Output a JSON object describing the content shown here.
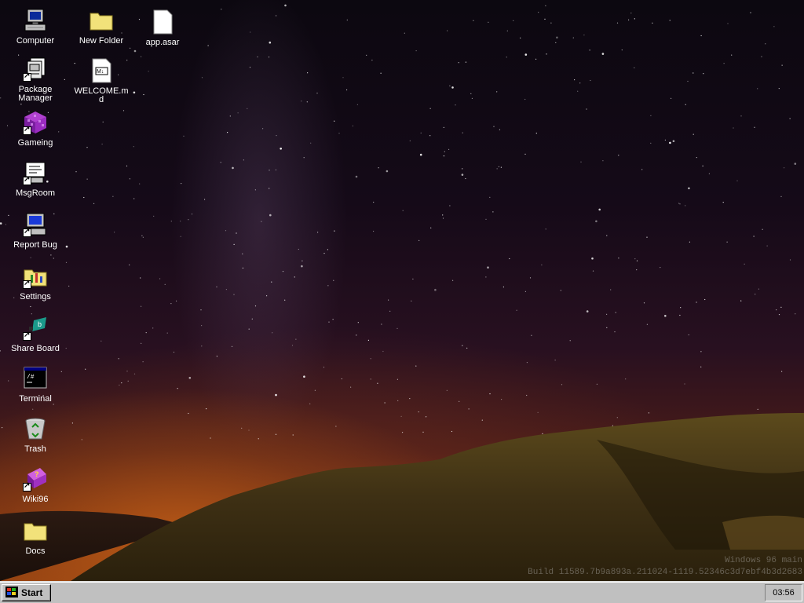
{
  "desktop": {
    "icons": [
      {
        "label": "Computer",
        "icon": "computer-icon"
      },
      {
        "label": "Package Manager",
        "icon": "package-manager-icon"
      },
      {
        "label": "Gameing",
        "icon": "gaming-cube-icon"
      },
      {
        "label": "MsgRoom",
        "icon": "msgroom-icon"
      },
      {
        "label": "Report Bug",
        "icon": "report-bug-icon"
      },
      {
        "label": "Settings",
        "icon": "settings-folder-icon"
      },
      {
        "label": "Share Board",
        "icon": "share-board-icon"
      },
      {
        "label": "Terminal",
        "icon": "terminal-icon"
      },
      {
        "label": "Trash",
        "icon": "trash-icon"
      },
      {
        "label": "Wiki96",
        "icon": "wiki-book-icon"
      },
      {
        "label": "Docs",
        "icon": "folder-icon"
      },
      {
        "label": "New Folder",
        "icon": "folder-icon"
      },
      {
        "label": "WELCOME.md",
        "icon": "markdown-file-icon"
      },
      {
        "label": "app.asar",
        "icon": "file-icon"
      }
    ],
    "watermark": {
      "line1": "Windows 96 main",
      "line2": "Build 11589.7b9a893a.211024-1119.52346c3d7ebf4b3d2683"
    }
  },
  "taskbar": {
    "start_label": "Start",
    "clock": "03:56"
  },
  "colors": {
    "taskbar": "#c0c0c0",
    "folder": "#f2e27a",
    "label_text": "#ffffff"
  }
}
